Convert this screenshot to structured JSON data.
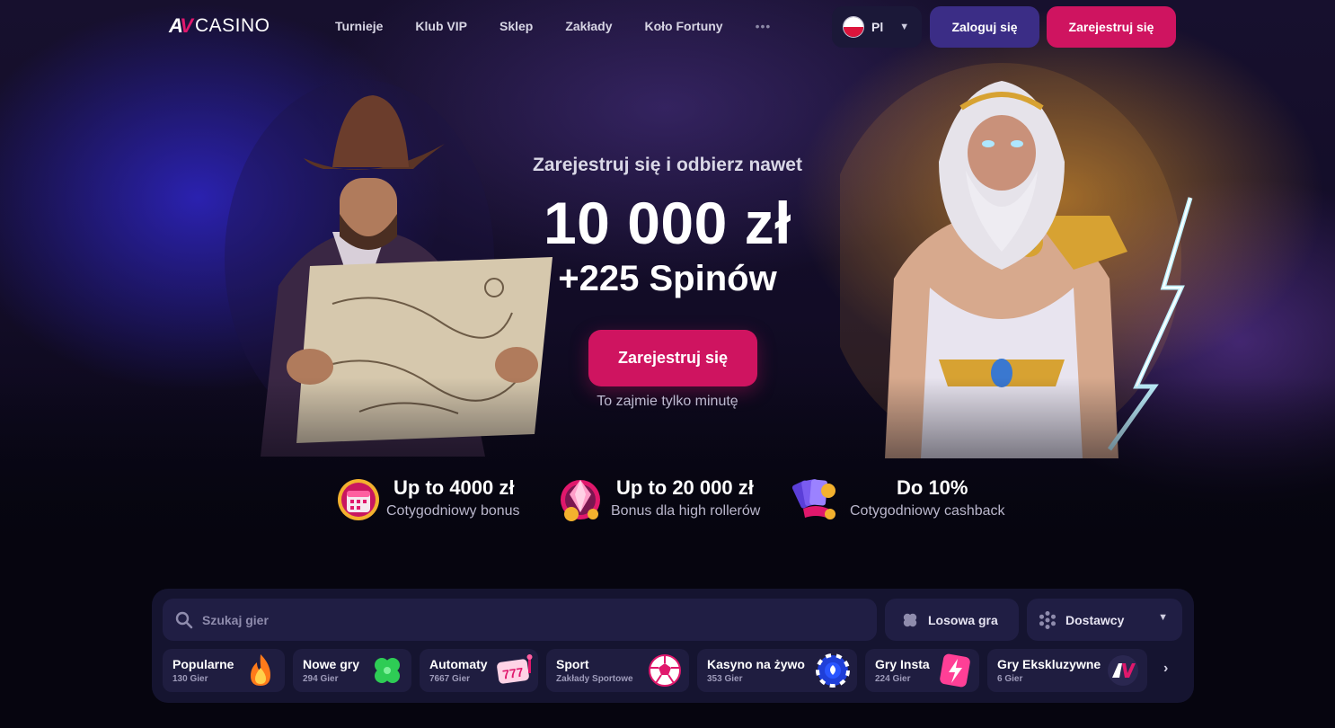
{
  "header": {
    "logo_text": "CASINO",
    "nav": [
      "Turnieje",
      "Klub VIP",
      "Sklep",
      "Zakłady",
      "Koło Fortuny"
    ],
    "more": "•••",
    "language": "Pl",
    "login_label": "Zaloguj się",
    "register_label": "Zarejestruj się"
  },
  "hero": {
    "subtitle": "Zarejestruj się i odbierz nawet",
    "amount": "10 000 zł",
    "spins": "+225 Spinów",
    "cta_label": "Zarejestruj się",
    "note": "To zajmie tylko minutę"
  },
  "perks": [
    {
      "title": "Up to 4000 zł",
      "desc": "Cotygodniowy bonus",
      "icon": "calendar-gift-icon"
    },
    {
      "title": "Up to 20 000 zł",
      "desc": "Bonus dla high rollerów",
      "icon": "diamond-coin-icon"
    },
    {
      "title": "Do 10%",
      "desc": "Cotygodniowy cashback",
      "icon": "cards-cashback-icon"
    }
  ],
  "games": {
    "search_placeholder": "Szukaj gier",
    "random_label": "Losowa gra",
    "providers_label": "Dostawcy",
    "categories": [
      {
        "name": "Popularne",
        "count": "130 Gier",
        "icon": "flame-icon"
      },
      {
        "name": "Nowe gry",
        "count": "294 Gier",
        "icon": "clover-icon"
      },
      {
        "name": "Automaty",
        "count": "7667 Gier",
        "icon": "slot-777-icon"
      },
      {
        "name": "Sport",
        "count": "Zakłady Sportowe",
        "icon": "soccer-ball-icon"
      },
      {
        "name": "Kasyno na żywo",
        "count": "353 Gier",
        "icon": "poker-chip-icon"
      },
      {
        "name": "Gry Insta",
        "count": "224 Gier",
        "icon": "lightning-icon"
      },
      {
        "name": "Gry Ekskluzywne",
        "count": "6 Gier",
        "icon": "av-logo-icon"
      }
    ]
  },
  "colors": {
    "accent": "#cf1460",
    "login": "#3b2d86",
    "panel": "#151430",
    "tile": "#1f1d40"
  }
}
